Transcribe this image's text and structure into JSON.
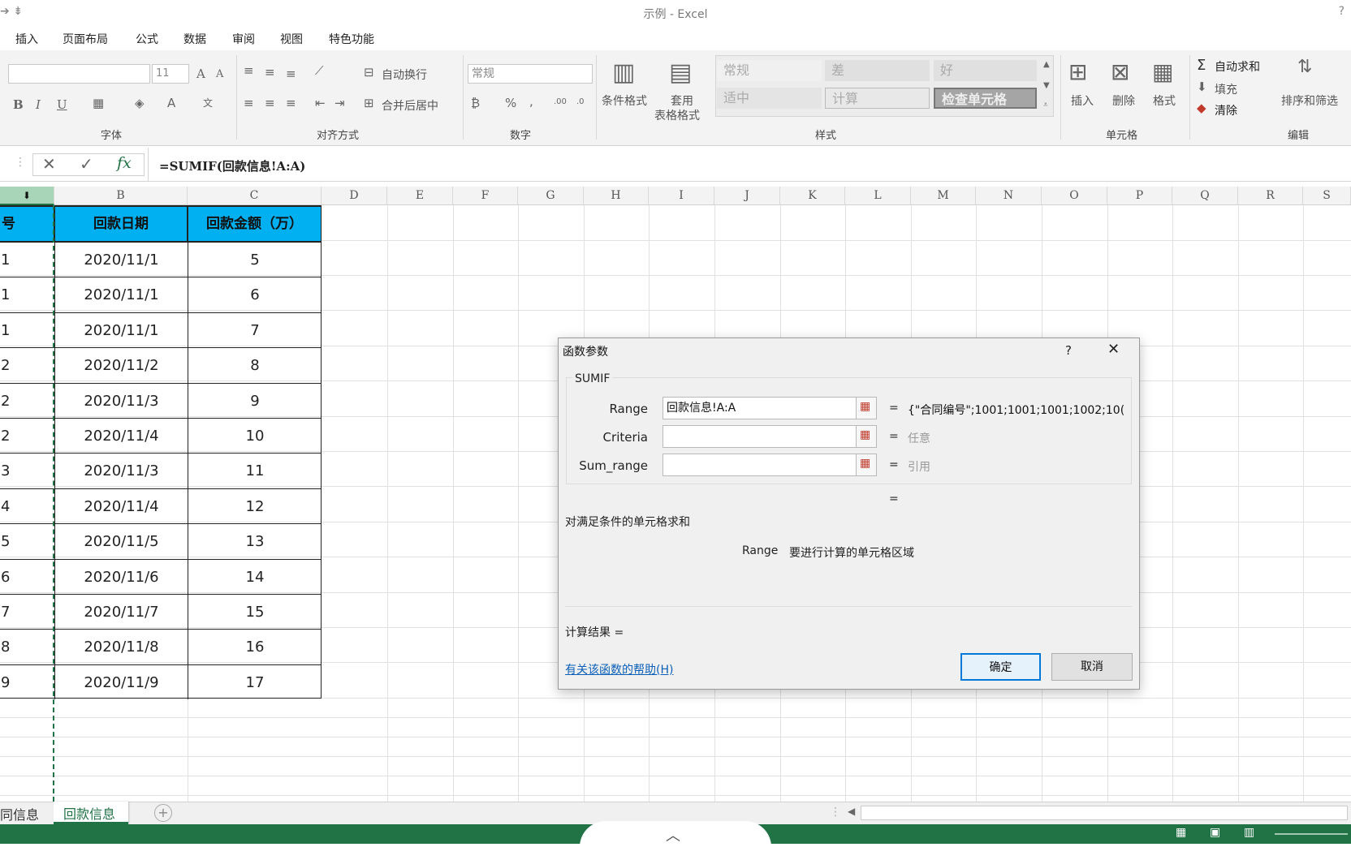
{
  "window": {
    "title": "示例 - Excel",
    "help": "?"
  },
  "qat": {
    "arrow": "➔",
    "more": "⇟"
  },
  "menu_tabs": [
    "插入",
    "页面布局",
    "公式",
    "数据",
    "审阅",
    "视图",
    "特色功能"
  ],
  "ribbon": {
    "font": {
      "size": "11",
      "group_label": "字体",
      "bold": "B",
      "italic": "I",
      "underline": "U",
      "grow": "A",
      "shrink": "A"
    },
    "alignment": {
      "wrap": "自动换行",
      "merge": "合并后居中",
      "group_label": "对齐方式"
    },
    "number": {
      "format": "常规",
      "percent": "%",
      "comma": ",",
      "group_label": "数字"
    },
    "styles": {
      "conditional": "条件格式",
      "table_format_1": "套用",
      "table_format_2": "表格格式",
      "cells": [
        "常规",
        "差",
        "好",
        "适中",
        "计算",
        "检查单元格"
      ],
      "group_label": "样式"
    },
    "cells_group": {
      "insert": "插入",
      "delete": "删除",
      "format": "格式",
      "group_label": "单元格"
    },
    "editing": {
      "autosum": "自动求和",
      "fill": "填充",
      "clear": "清除",
      "sort": "排序和筛选",
      "group_label": "编辑"
    }
  },
  "formula_bar": {
    "formula": "=SUMIF(回款信息!A:A)",
    "fx": "fx"
  },
  "columns": [
    "B",
    "C",
    "D",
    "E",
    "F",
    "G",
    "H",
    "I",
    "J",
    "K",
    "L",
    "M",
    "N",
    "O",
    "P",
    "Q",
    "R",
    "S"
  ],
  "table": {
    "headers": [
      "号",
      "回款日期",
      "回款金额（万）"
    ],
    "rows": [
      [
        "1",
        "2020/11/1",
        "5"
      ],
      [
        "1",
        "2020/11/1",
        "6"
      ],
      [
        "1",
        "2020/11/1",
        "7"
      ],
      [
        "2",
        "2020/11/2",
        "8"
      ],
      [
        "2",
        "2020/11/3",
        "9"
      ],
      [
        "2",
        "2020/11/4",
        "10"
      ],
      [
        "3",
        "2020/11/3",
        "11"
      ],
      [
        "4",
        "2020/11/4",
        "12"
      ],
      [
        "5",
        "2020/11/5",
        "13"
      ],
      [
        "6",
        "2020/11/6",
        "14"
      ],
      [
        "7",
        "2020/11/7",
        "15"
      ],
      [
        "8",
        "2020/11/8",
        "16"
      ],
      [
        "9",
        "2020/11/9",
        "17"
      ]
    ]
  },
  "sheet_tabs": [
    "同信息",
    "回款信息"
  ],
  "dialog": {
    "title": "函数参数",
    "help": "?",
    "function_name": "SUMIF",
    "args": [
      {
        "label": "Range",
        "value": "回款信息!A:A",
        "result": "{\"合同编号\";1001;1001;1001;1002;10("
      },
      {
        "label": "Criteria",
        "value": "",
        "result": "任意"
      },
      {
        "label": "Sum_range",
        "value": "",
        "result": "引用"
      }
    ],
    "eq": "=",
    "description": "对满足条件的单元格求和",
    "arg_help_name": "Range",
    "arg_help_text": "要进行计算的单元格区域",
    "result_label": "计算结果 =",
    "help_link": "有关该函数的帮助(H)",
    "ok": "确定",
    "cancel": "取消"
  }
}
